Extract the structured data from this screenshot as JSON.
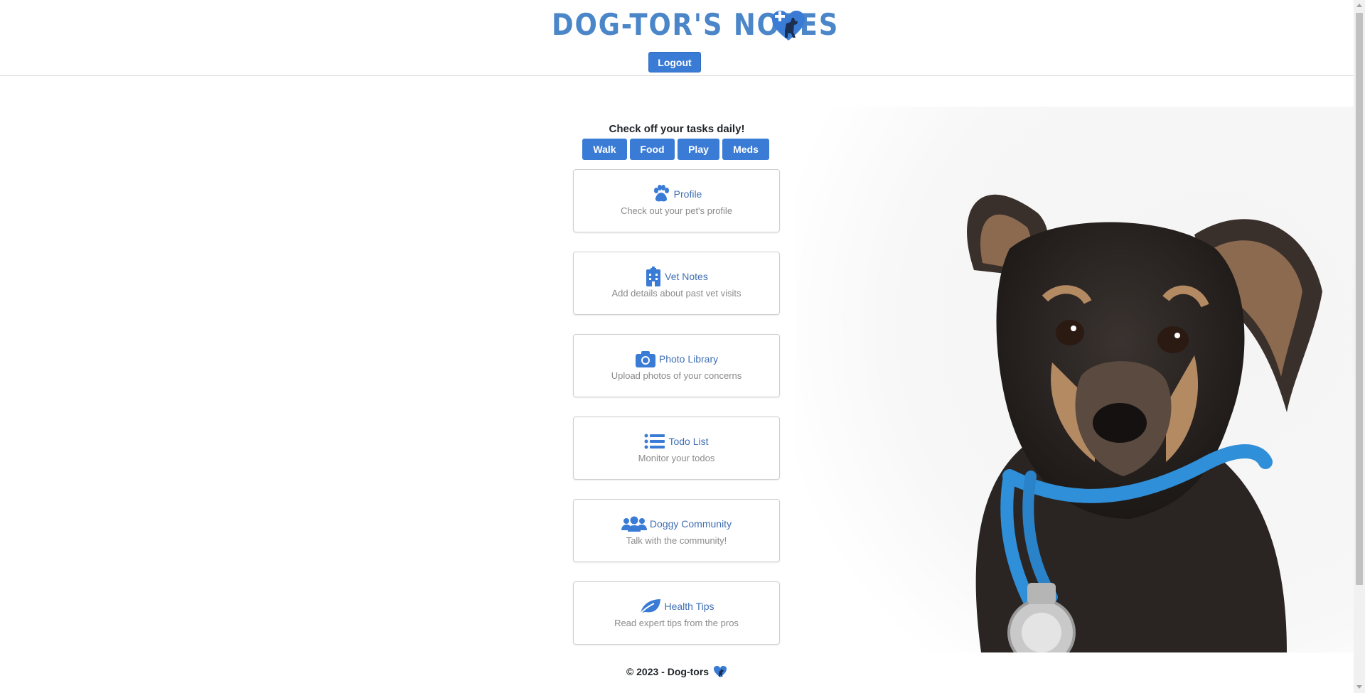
{
  "header": {
    "title": "DOG-TOR'S NOTES",
    "logo_icon": "dog-heart-medical-icon",
    "logout_label": "Logout"
  },
  "tasks": {
    "title": "Check off your tasks daily!",
    "buttons": [
      "Walk",
      "Food",
      "Play",
      "Meds"
    ]
  },
  "cards": [
    {
      "title": "Profile",
      "subtitle": "Check out your pet's profile",
      "icon": "paw-icon"
    },
    {
      "title": "Vet Notes",
      "subtitle": "Add details about past vet visits",
      "icon": "hospital-icon"
    },
    {
      "title": "Photo Library",
      "subtitle": "Upload photos of your concerns",
      "icon": "camera-icon"
    },
    {
      "title": "Todo List",
      "subtitle": "Monitor your todos",
      "icon": "list-icon"
    },
    {
      "title": "Doggy Community",
      "subtitle": "Talk with the community!",
      "icon": "users-icon"
    },
    {
      "title": "Health Tips",
      "subtitle": "Read expert tips from the pros",
      "icon": "leaf-icon"
    }
  ],
  "footer": {
    "text": "© 2023 - Dog-tors",
    "icon": "dog-heart-icon"
  },
  "colors": {
    "accent": "#3a7bd5",
    "link": "#3f6fb3",
    "brand": "#4a86c8",
    "muted": "#8a8a8a"
  }
}
